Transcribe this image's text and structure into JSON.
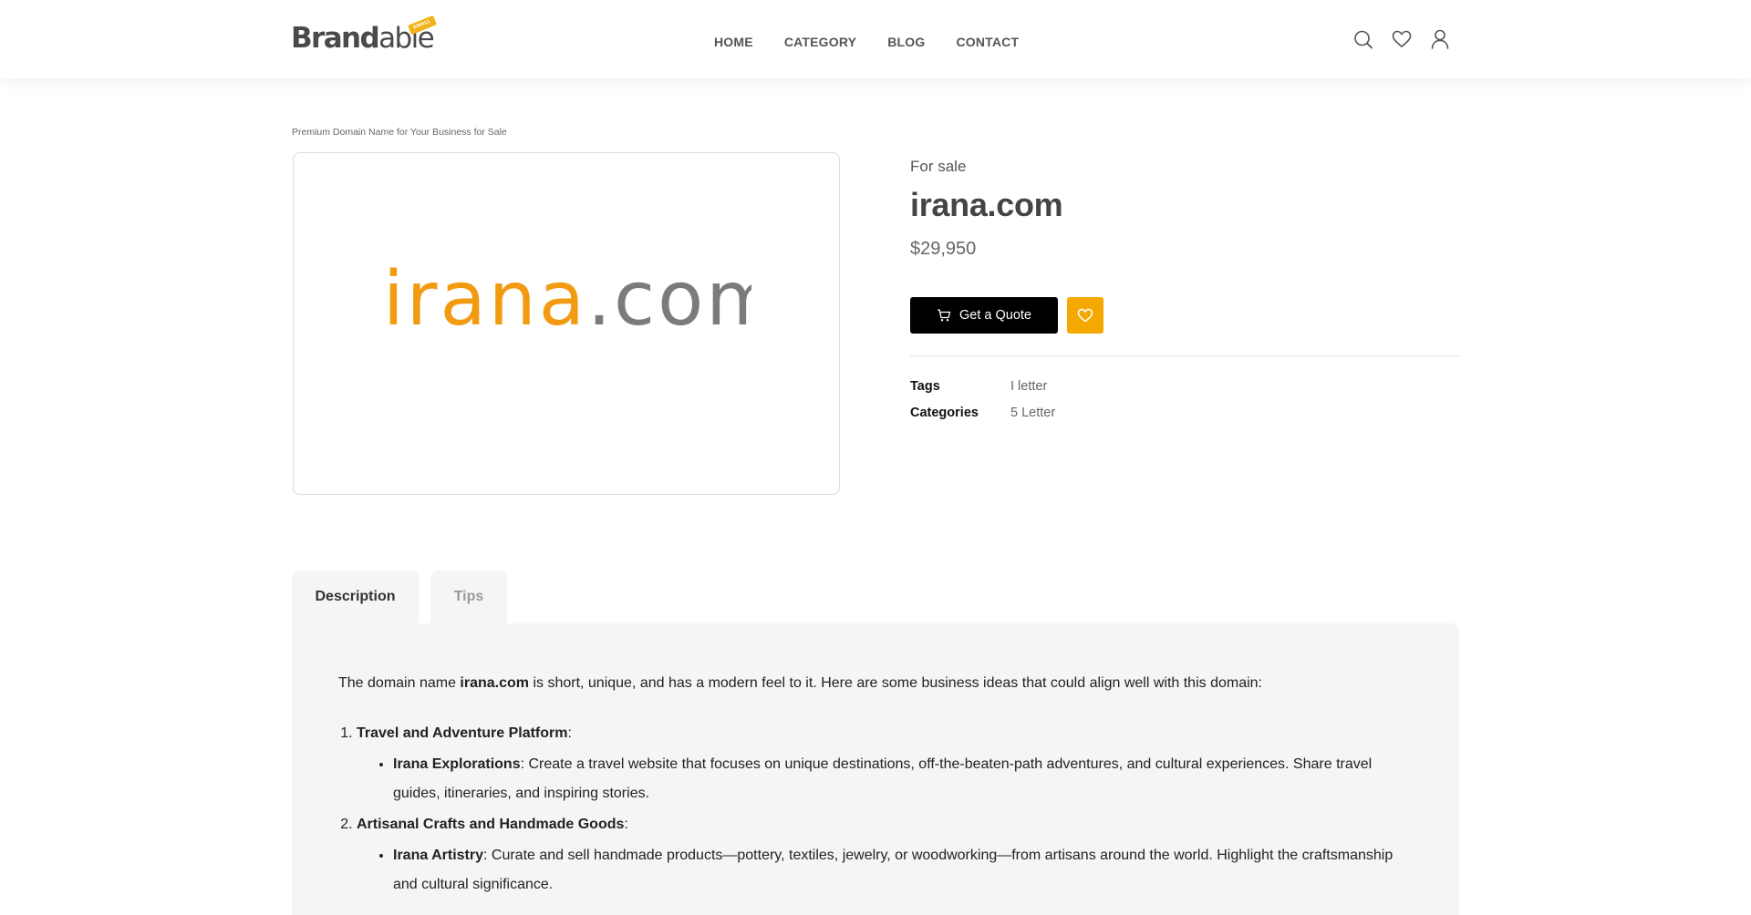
{
  "header": {
    "logo_part1": "Brand",
    "logo_part2": "able",
    "logo_tag": "SMALL",
    "nav": [
      "HOME",
      "CATEGORY",
      "BLOG",
      "CONTACT"
    ],
    "icons": [
      "search-icon",
      "heart-icon",
      "user-icon"
    ]
  },
  "breadcrumb": "Premium Domain Name for Your Business for Sale",
  "product": {
    "domain_logo_name": "irana",
    "domain_logo_tld": ".com",
    "status": "For sale",
    "title": "irana.com",
    "price": "$29,950",
    "quote_label": "Get a Quote",
    "tags_label": "Tags",
    "tags_value": "I letter",
    "categories_label": "Categories",
    "categories_value": "5 Letter"
  },
  "colors": {
    "accent": "#f5a800",
    "logo_orange": "#f29a12",
    "logo_gray": "#7b7b7b",
    "button": "#000000"
  },
  "tabs": [
    "Description",
    "Tips"
  ],
  "description": {
    "intro_before": "The domain name ",
    "intro_bold": "irana.com",
    "intro_after": " is short, unique, and has a modern feel to it. Here are some business ideas that could align well with this domain:",
    "items": [
      {
        "title": "Travel and Adventure Platform",
        "sub_bold": "Irana Explorations",
        "sub_text": ": Create a travel website that focuses on unique destinations, off-the-beaten-path adventures, and cultural experiences. Share travel guides, itineraries, and inspiring stories."
      },
      {
        "title": "Artisanal Crafts and Handmade Goods",
        "sub_bold": "Irana Artistry",
        "sub_text": ": Curate and sell handmade products—pottery, textiles, jewelry, or woodworking—from artisans around the world. Highlight the craftsmanship and cultural significance."
      }
    ]
  }
}
